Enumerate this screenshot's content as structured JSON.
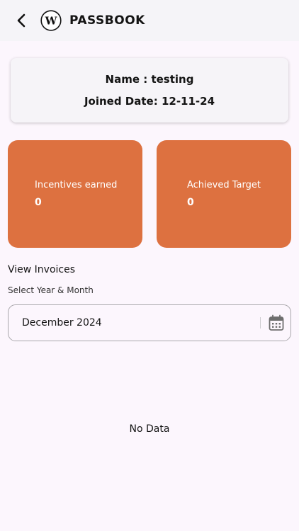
{
  "header": {
    "title": "PASSBOOK",
    "back_icon": "chevron-left-icon",
    "logo_letter": "W"
  },
  "profile": {
    "name_text": "Name : testing",
    "joined_text": "Joined Date: 12-11-24"
  },
  "stats": [
    {
      "label": "Incentives earned",
      "value": "0"
    },
    {
      "label": "Achieved Target",
      "value": "0"
    }
  ],
  "invoices": {
    "title": "View Invoices",
    "picker_label": "Select Year & Month",
    "selected_month": "December 2024",
    "picker_icon": "calendar-icon",
    "empty_message": "No Data"
  },
  "colors": {
    "accent": "#dd7140",
    "background": "#fcf6fd",
    "appbar": "#f5f4f8"
  }
}
